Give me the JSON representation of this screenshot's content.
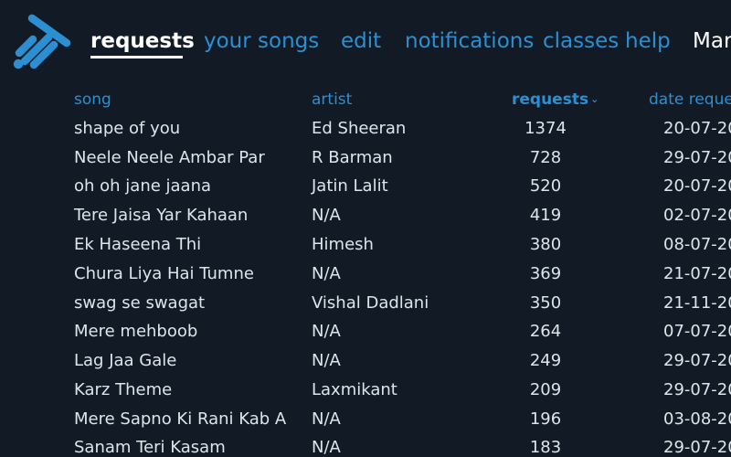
{
  "nav": {
    "links": [
      {
        "label": "requests",
        "active": true
      },
      {
        "label": "your songs",
        "active": false
      },
      {
        "label": "edit",
        "active": false
      },
      {
        "label": "notifications",
        "active": false
      },
      {
        "label": "classes",
        "active": false
      },
      {
        "label": "help",
        "active": false
      }
    ],
    "user": "Mar"
  },
  "table": {
    "headers": {
      "song": "song",
      "artist": "artist",
      "requests": "requests",
      "date": "date reque"
    },
    "sort_indicator": "chevron-down",
    "rows": [
      {
        "song": "shape of you",
        "artist": "Ed Sheeran",
        "requests": "1374",
        "date": "20-07-20"
      },
      {
        "song": "Neele Neele Ambar Par",
        "artist": "R Barman",
        "requests": "728",
        "date": "29-07-20"
      },
      {
        "song": "oh oh jane jaana",
        "artist": "Jatin Lalit",
        "requests": "520",
        "date": "20-07-20"
      },
      {
        "song": "Tere Jaisa Yar Kahaan",
        "artist": "N/A",
        "requests": "419",
        "date": "02-07-20"
      },
      {
        "song": "Ek Haseena Thi",
        "artist": "Himesh",
        "requests": "380",
        "date": "08-07-20"
      },
      {
        "song": "Chura Liya Hai Tumne",
        "artist": "N/A",
        "requests": "369",
        "date": "21-07-20"
      },
      {
        "song": "swag se swagat",
        "artist": "Vishal Dadlani",
        "requests": "350",
        "date": "21-11-20"
      },
      {
        "song": "Mere mehboob",
        "artist": "N/A",
        "requests": "264",
        "date": "07-07-20"
      },
      {
        "song": "Lag Jaa Gale",
        "artist": "N/A",
        "requests": "249",
        "date": "29-07-20"
      },
      {
        "song": "Karz Theme",
        "artist": "Laxmikant",
        "requests": "209",
        "date": "29-07-20"
      },
      {
        "song": "Mere Sapno Ki Rani Kab A",
        "artist": "N/A",
        "requests": "196",
        "date": "03-08-20"
      },
      {
        "song": "Sanam Teri Kasam",
        "artist": "N/A",
        "requests": "183",
        "date": "29-07-20"
      }
    ]
  },
  "colors": {
    "background": "#121b25",
    "accent": "#2b8fd1",
    "text": "#dfe4ea",
    "active_nav": "#ffffff"
  }
}
